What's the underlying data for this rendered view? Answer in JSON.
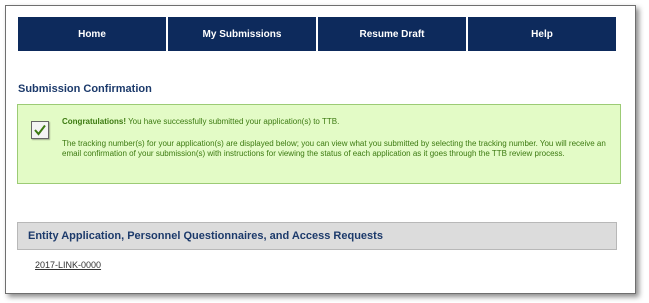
{
  "nav": {
    "items": [
      {
        "label": "Home"
      },
      {
        "label": "My Submissions"
      },
      {
        "label": "Resume Draft"
      },
      {
        "label": "Help"
      }
    ]
  },
  "page": {
    "title": "Submission Confirmation"
  },
  "confirmation": {
    "congrats_label": "Congratulations!",
    "congrats_text": " You have successfully submitted your application(s) to TTB.",
    "detail_text": "The tracking number(s) for your application(s) are displayed below; you can view what you submitted by selecting the tracking number. You will receive an email confirmation of your submission(s) with instructions for viewing the status of each application as it goes through the TTB review process.",
    "icon": "checkmark-icon"
  },
  "section": {
    "title": "Entity Application, Personnel Questionnaires, and Access Requests",
    "links": [
      {
        "label": "2017-LINK-0000"
      }
    ]
  },
  "colors": {
    "nav_bg": "#0d2a5c",
    "title_color": "#1c3a6b",
    "success_bg": "#e3fbc6",
    "success_text": "#3c7a11"
  }
}
